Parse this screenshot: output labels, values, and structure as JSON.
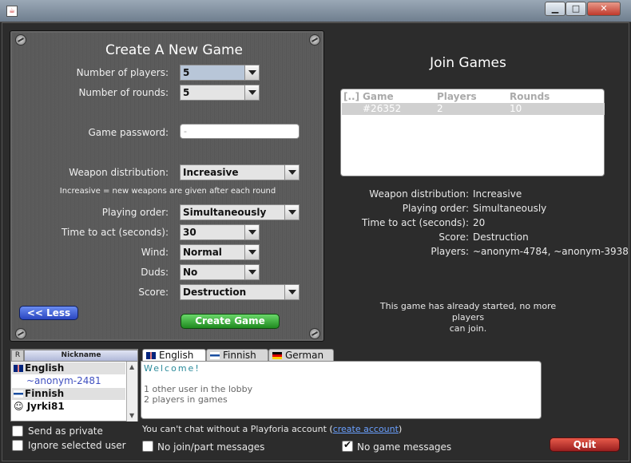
{
  "window": {
    "icon": "java-icon",
    "minimize": "▁",
    "maximize": "□",
    "close": "✕"
  },
  "create": {
    "title": "Create A New Game",
    "players_label": "Number of players:",
    "players_value": "5",
    "rounds_label": "Number of rounds:",
    "rounds_value": "5",
    "password_label": "Game password:",
    "password_placeholder": "-",
    "weapon_label": "Weapon distribution:",
    "weapon_value": "Increasive",
    "weapon_hint": "Increasive = new weapons are given after each round",
    "order_label": "Playing order:",
    "order_value": "Simultaneously",
    "time_label": "Time to act (seconds):",
    "time_value": "30",
    "wind_label": "Wind:",
    "wind_value": "Normal",
    "duds_label": "Duds:",
    "duds_value": "No",
    "score_label": "Score:",
    "score_value": "Destruction",
    "less_button": "<< Less",
    "create_button": "Create Game"
  },
  "join": {
    "title": "Join Games",
    "columns": [
      "[..]",
      "Game",
      "Players",
      "Rounds"
    ],
    "rows": [
      {
        "game": "#26352",
        "players": "2",
        "rounds": "10"
      }
    ],
    "details": [
      {
        "label": "Weapon distribution:",
        "value": "Increasive"
      },
      {
        "label": "Playing order:",
        "value": "Simultaneously"
      },
      {
        "label": "Time to act (seconds):",
        "value": "20"
      },
      {
        "label": "Score:",
        "value": "Destruction"
      },
      {
        "label": "Players:",
        "value": "~anonym-4784, ~anonym-3938"
      }
    ],
    "status_line1": "This game has already started, no more players",
    "status_line2": "can join."
  },
  "lobby": {
    "r_header": "R",
    "nick_header": "Nickname",
    "groups": [
      {
        "lang": "English",
        "users": [
          "~anonym-2481"
        ]
      },
      {
        "lang": "Finnish",
        "users": [
          "Jyrki81"
        ]
      }
    ],
    "send_private": "Send as private",
    "ignore_user": "Ignore selected user"
  },
  "chat": {
    "tabs": [
      "English",
      "Finnish",
      "German"
    ],
    "welcome": "Welcome!",
    "line1": "1 other user in the lobby",
    "line2": "2 players in games",
    "no_account_text": "You can't chat without a Playforia account (",
    "no_account_link": "create account",
    "no_account_end": ")",
    "no_joinpart": "No join/part messages",
    "no_game_msgs": "No game messages"
  },
  "quit_button": "Quit"
}
